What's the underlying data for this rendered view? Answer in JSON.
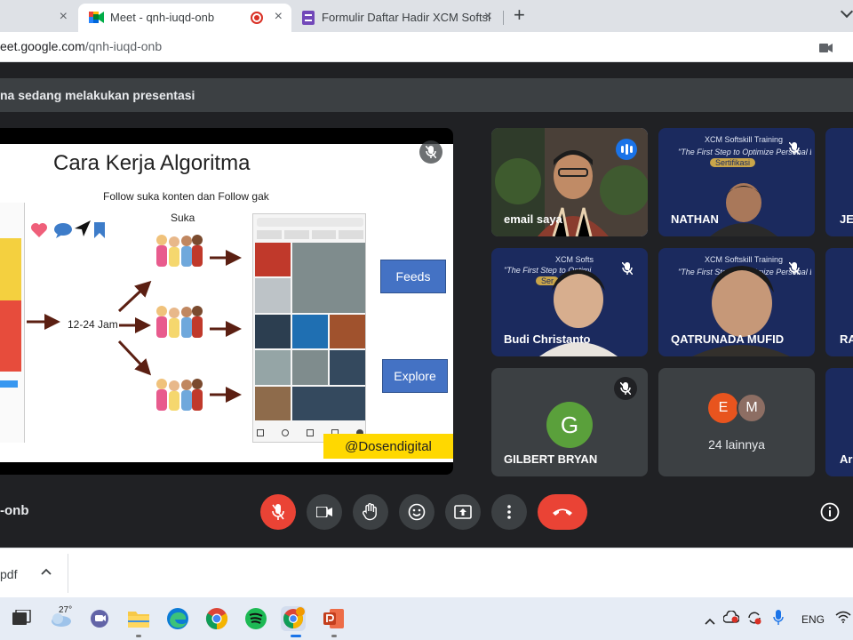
{
  "browser": {
    "tabs": [
      {
        "label": "",
        "close": "×"
      },
      {
        "label": "Meet - qnh-iuqd-onb",
        "close": "×"
      },
      {
        "label": "Formulir Daftar Hadir XCM Softsk",
        "close": "×"
      }
    ],
    "new_tab": "+",
    "url_domain": "eet.google.com",
    "url_path": "/qnh-iuqd-onb"
  },
  "meet": {
    "presenting_banner": "na sedang melakukan presentasi",
    "presenter_name": "h Al Banna",
    "slide": {
      "title": "Cara Kerja Algoritma",
      "subtitle": "Follow suka konten dan Follow gak",
      "suka_label": "Suka",
      "jam_label": "12-24 Jam",
      "box_feeds": "Feeds",
      "box_explore": "Explore",
      "handle": "@Dosendigital"
    },
    "participants": [
      {
        "name": "email saya",
        "speaking": true
      },
      {
        "name": "NATHAN",
        "muted": true,
        "banner_line1": "XCM Softskill Training",
        "banner_line2": "\"The First Step to Optimize Personal Branding in Digital Era\"",
        "banner_line3": "Sertifikasi"
      },
      {
        "name": "JE"
      },
      {
        "name": "Budi Christanto",
        "muted": true,
        "banner_line1": "XCM Softs",
        "banner_line2": "\"The First Step to Optimi",
        "banner_line3": "Ser"
      },
      {
        "name": "QATRUNADA MUFID",
        "muted": true,
        "banner_line1": "XCM Softskill Training",
        "banner_line2": "\"The First Step to Optimize Personal Branding in Digital Era\"",
        "banner_line3": "Sertifikasi"
      },
      {
        "name": "RA"
      },
      {
        "name": "GILBERT BRYAN",
        "avatar_letter": "G",
        "avatar_color": "#5aa03b",
        "muted": true
      },
      {
        "name": "Ar"
      }
    ],
    "more": {
      "count_text": "24 lainnya",
      "avatars": [
        {
          "letter": "E",
          "color": "#e8541e"
        },
        {
          "letter": "M",
          "color": "#8d6e63"
        }
      ]
    },
    "meeting_code": "-onb"
  },
  "download": {
    "file_name": "pdf",
    "chevron": "^"
  },
  "taskbar": {
    "temperature": "27°",
    "language": "ENG"
  },
  "colors": {
    "meet_bg": "#202124",
    "tile_bg": "#3c4043",
    "accent": "#8ab4f8",
    "red": "#ea4335",
    "green": "#5aa03b"
  }
}
